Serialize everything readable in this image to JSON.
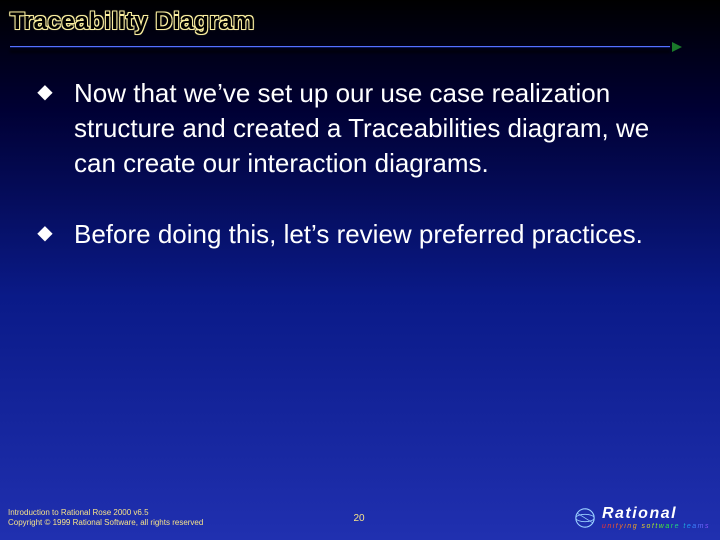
{
  "title": "Traceability Diagram",
  "bullets": [
    "Now that we’ve set up our use case realization structure and created a Traceabilities diagram, we can create our interaction diagrams.",
    "Before doing this, let’s review preferred practices."
  ],
  "footer": {
    "line1": "Introduction to Rational Rose 2000 v6.5",
    "line2": "Copyright © 1999 Rational Software, all rights reserved",
    "page": "20"
  },
  "brand": {
    "name": "Rational",
    "tagline": "unifying software teams"
  }
}
